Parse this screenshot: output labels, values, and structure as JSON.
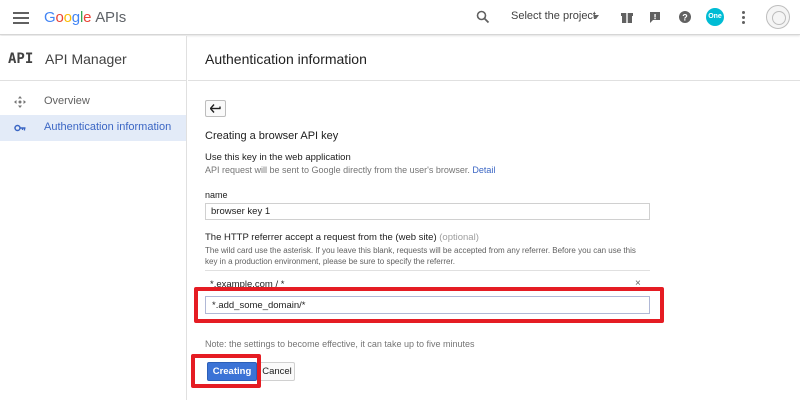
{
  "header": {
    "logo_google": [
      "G",
      "o",
      "o",
      "g",
      "l",
      "e"
    ],
    "logo_apis": "APIs",
    "project_select": "Select the project",
    "badge_text": "One"
  },
  "sidebar": {
    "logo_text": "API",
    "title": "API Manager",
    "items": [
      {
        "label": "Overview",
        "icon": "move-icon",
        "active": false
      },
      {
        "label": "Authentication information",
        "icon": "key-icon",
        "active": true
      }
    ]
  },
  "main": {
    "title": "Authentication information",
    "form_title": "Creating a browser API key",
    "usage_heading": "Use this key in the web application",
    "usage_note": "API request will be sent to Google directly from the user's browser.",
    "detail_link": "Detail",
    "name_label": "name",
    "name_value": "browser key 1",
    "referrer_label": "The HTTP referrer accept a request from the (web site)",
    "referrer_optional": "(optional)",
    "referrer_desc": "The wild card use the asterisk. If you leave this blank, requests will be accepted from any referrer. Before you can use this key in a production environment, please be sure to specify the referrer.",
    "referrer_item": "*.example.com / *",
    "referrer_remove": "×",
    "referrer_input_value": "*.add_some_domain/*",
    "footnote": "Note: the settings to become effective, it can take up to five minutes",
    "create_button": "Creating",
    "cancel_button": "Cancel"
  },
  "colors": {
    "accent": "#3b73d6",
    "highlight": "#e51c23",
    "active_bg": "#e3ebf8"
  }
}
